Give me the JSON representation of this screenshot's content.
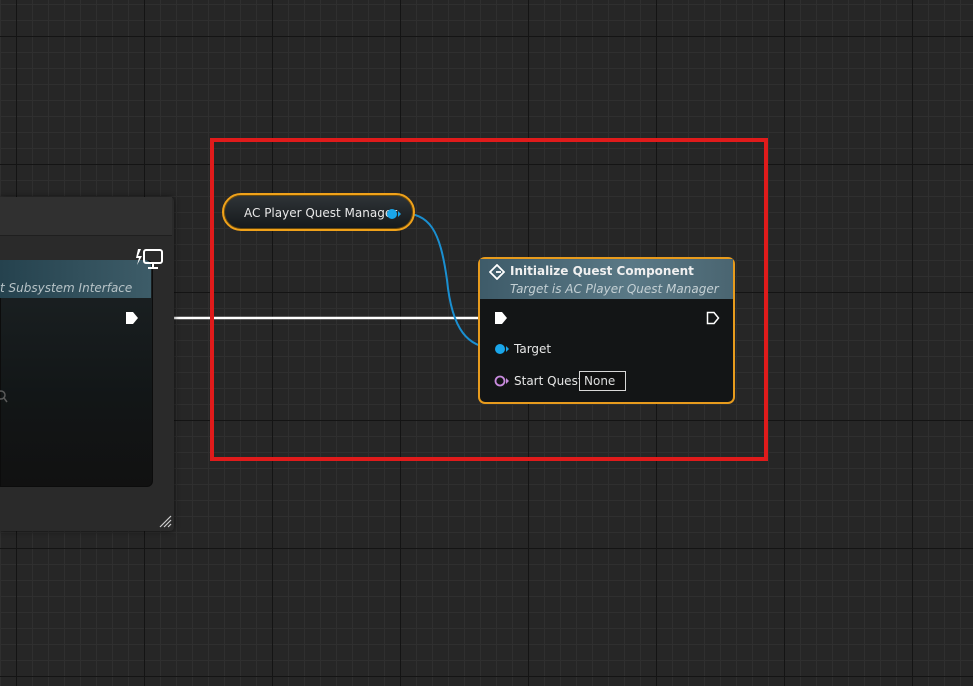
{
  "canvas": {
    "grid": "on"
  },
  "left_node": {
    "subtitle": "t Subsystem Interface",
    "icons": [
      "monitor-icon",
      "search-icon",
      "resize-grip-icon"
    ]
  },
  "getter_node": {
    "label": "AC Player Quest Manager",
    "output_pin_color": "#1aa6ea",
    "border_color": "#f0a21a"
  },
  "function_node": {
    "title": "Initialize Quest Component",
    "subtitle": "Target is AC Player Quest Manager",
    "pins": {
      "target_label": "Target",
      "start_quest_label": "Start Quest",
      "start_quest_value": "None"
    },
    "border_color": "#e79b1d"
  },
  "colors": {
    "selection": "#e01b1b",
    "object_pin": "#1aa6ea",
    "name_pin": "#c98bde",
    "exec_wire": "#ffffff"
  }
}
